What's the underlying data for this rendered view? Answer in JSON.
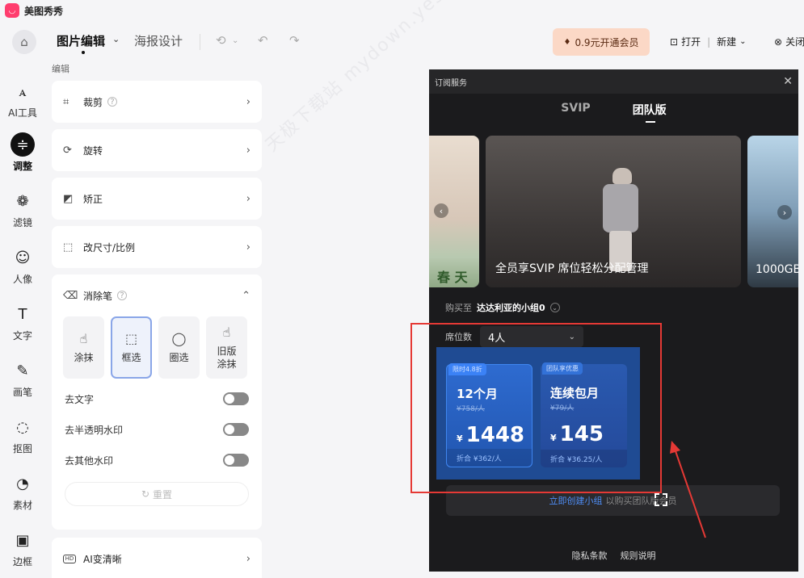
{
  "app": {
    "name": "美图秀秀",
    "logo_glyph": "◡"
  },
  "toolbar": {
    "tab_image_edit": "图片编辑",
    "tab_poster": "海报设计",
    "vip_label": "0.9元开通会员",
    "open_label": "打开",
    "new_label": "新建",
    "close_label": "关闭"
  },
  "left_nav": [
    {
      "label": "AI工具",
      "glyph": "ꭺ",
      "icon": "ai-icon"
    },
    {
      "label": "调整",
      "glyph": "≑",
      "icon": "adjust-icon",
      "active": true
    },
    {
      "label": "滤镜",
      "glyph": "❁",
      "icon": "filter-icon"
    },
    {
      "label": "人像",
      "glyph": "☺",
      "icon": "portrait-icon"
    },
    {
      "label": "文字",
      "glyph": "T",
      "icon": "text-icon"
    },
    {
      "label": "画笔",
      "glyph": "✎",
      "icon": "brush-icon"
    },
    {
      "label": "抠图",
      "glyph": "◌",
      "icon": "cutout-icon"
    },
    {
      "label": "素材",
      "glyph": "◔",
      "icon": "material-icon"
    },
    {
      "label": "边框",
      "glyph": "▣",
      "icon": "frame-icon"
    }
  ],
  "panel": {
    "heading": "编辑",
    "crop": "裁剪",
    "rotate": "旋转",
    "correct": "矫正",
    "resize": "改尺寸/比例",
    "eraser": "消除笔",
    "tools": [
      {
        "label": "涂抹",
        "glyph": "☝"
      },
      {
        "label": "框选",
        "glyph": "⬚",
        "selected": true
      },
      {
        "label": "圈选",
        "glyph": "◯"
      },
      {
        "label": "旧版涂抹",
        "glyph": "☝"
      }
    ],
    "toggles": [
      "去文字",
      "去半透明水印",
      "去其他水印"
    ],
    "reset": "重置",
    "ai_clear": "AI变清晰",
    "ai_badge": "HD"
  },
  "dialog": {
    "title": "订阅服务",
    "tab_svip": "SVIP",
    "tab_team": "团队版",
    "banner_left_text": "春 天",
    "banner_main_caption": "全员享SVIP 席位轻松分配管理",
    "banner_right_caption": "1000GB",
    "buy_for_label": "购买至",
    "team_name": "达达利亚的小组0",
    "seats_label": "席位数",
    "seats_value": "4人",
    "cards": [
      {
        "badge": "限时4.8折",
        "duration": "12个月",
        "original": "¥758/人",
        "currency": "¥",
        "price": "1448",
        "unit": "折合 ¥362/人"
      },
      {
        "badge": "团队享优惠",
        "duration": "连续包月",
        "original": "¥79/人",
        "currency": "¥",
        "price": "145",
        "unit": "折合 ¥36.25/人"
      }
    ],
    "create_link": "立即创建小组",
    "create_rest": "以购买团队版会员",
    "privacy": "隐私条款",
    "rules": "规则说明"
  },
  "watermark": "天极下载站 mydown.yesky.com"
}
